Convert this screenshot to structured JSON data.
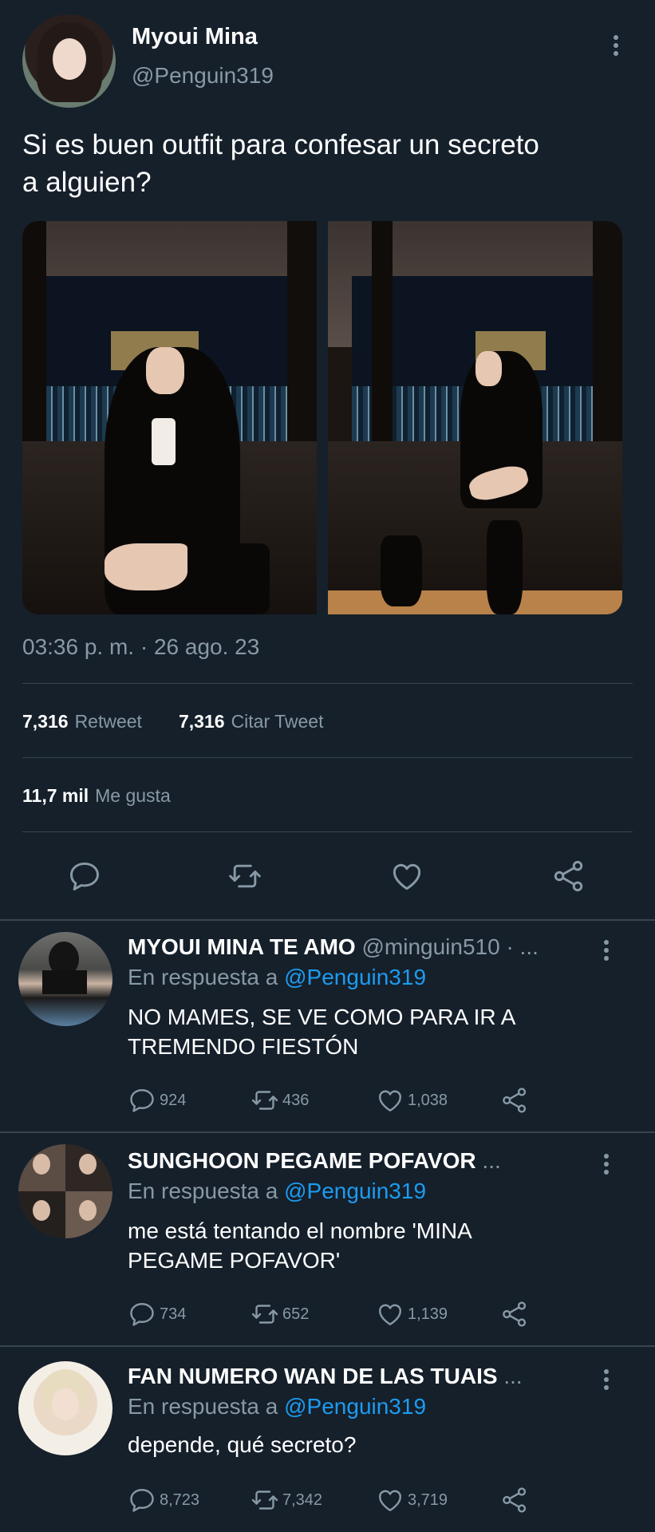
{
  "tweet": {
    "author_name": "Myoui Mina",
    "author_handle": "@Penguin319",
    "text_line1": "Si es buen outfit para confesar un secreto",
    "text_line2": "a alguien?",
    "timestamp": "03:36 p. m. · 26 ago. 23",
    "retweets": "7,316",
    "retweets_label": "Retweet",
    "quotes": "7,316",
    "quotes_label": "Citar Tweet",
    "likes": "11,7 mil",
    "likes_label": "Me gusta",
    "photo_count": 2
  },
  "actions": {
    "icons": [
      "reply-icon",
      "retweet-icon",
      "like-icon",
      "share-icon"
    ]
  },
  "replies": [
    {
      "name": "MYOUI MINA TE AMO",
      "handle": "@minguin510 · ...",
      "reply_prefix": "En respuesta a",
      "mention": "@Penguin319",
      "text_line1": "NO MAMES, SE VE COMO PARA IR A",
      "text_line2": "TREMENDO FIESTÓN",
      "replies": "924",
      "retweets": "436",
      "likes": "1,038"
    },
    {
      "name": "SUNGHOON PEGAME POFAVOR",
      "handle": "...",
      "reply_prefix": "En respuesta a",
      "mention": "@Penguin319",
      "text_line1": "me está tentando el nombre 'MINA",
      "text_line2": "PEGAME POFAVOR'",
      "replies": "734",
      "retweets": "652",
      "likes": "1,139"
    },
    {
      "name": "FAN NUMERO WAN DE LAS TUAIS",
      "handle": "...",
      "reply_prefix": "En respuesta a",
      "mention": "@Penguin319",
      "text_line1": "depende, qué secreto?",
      "text_line2": "",
      "replies": "8,723",
      "retweets": "7,342",
      "likes": "3,719"
    }
  ],
  "colors": {
    "background": "#15202b",
    "secondary_text": "#8899a6",
    "mention": "#1d9bf0",
    "divider": "#38444d"
  }
}
